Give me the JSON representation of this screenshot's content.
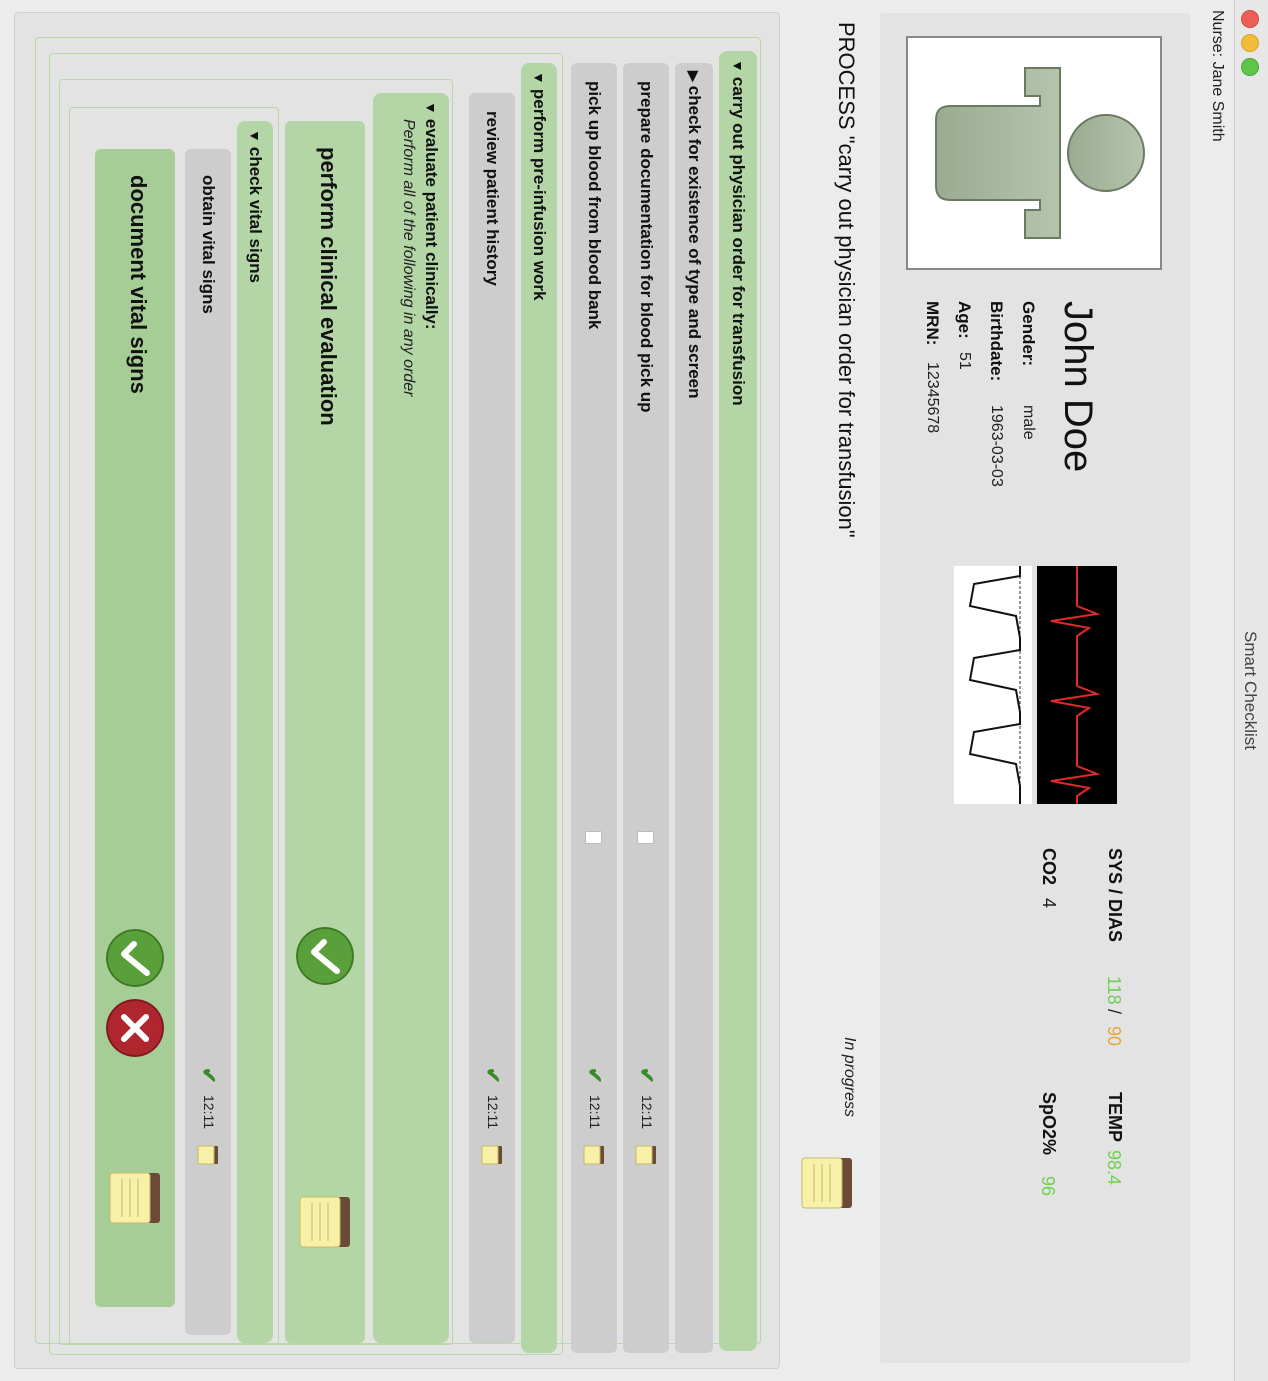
{
  "window": {
    "title": "Smart Checklist"
  },
  "nurse": "Nurse: Jane Smith",
  "patient": {
    "name": "John Doe",
    "gender_label": "Gender:",
    "gender": "male",
    "birthdate_label": "Birthdate:",
    "birthdate": "1963-03-03",
    "age_label": "Age:",
    "age": "51",
    "mrn_label": "MRN:",
    "mrn": "12345678"
  },
  "vitals": {
    "sysdias_label": "SYS / DIAS",
    "sys": "118",
    "slash": "/",
    "dias": "90",
    "temp_label": "TEMP",
    "temp": "98.4",
    "co2_label": "CO2",
    "co2": "4",
    "spo2_label": "SpO2%",
    "spo2": "96",
    "colors": {
      "normal": "#6fcf4f",
      "warning": "#e8a33a"
    }
  },
  "process": {
    "title": "PROCESS \"carry out physician order for transfusion\"",
    "status": "In progress"
  },
  "tree": {
    "root": "carry out physician order for transfusion",
    "check_type_screen": "check for existence of type and screen",
    "prepare_docs": "prepare documentation for blood pick up",
    "pickup_blood": "pick up blood from blood bank",
    "preinfusion": "perform pre-infusion work",
    "review_history": "review patient history",
    "evaluate": "evaluate patient clinically:",
    "evaluate_hint": "Perform all of the following in any order",
    "clinical_eval": "perform clinical evaluation",
    "check_vitals": "check vital signs",
    "obtain_vitals": "obtain vital signs",
    "document_vitals": "document vital signs",
    "time": "12:11",
    "check": "✔"
  },
  "colors": {
    "group_green": "#b4d6a6",
    "item_gray": "#cdcdcd",
    "accept": "#5aa03a",
    "reject": "#b0262e"
  }
}
